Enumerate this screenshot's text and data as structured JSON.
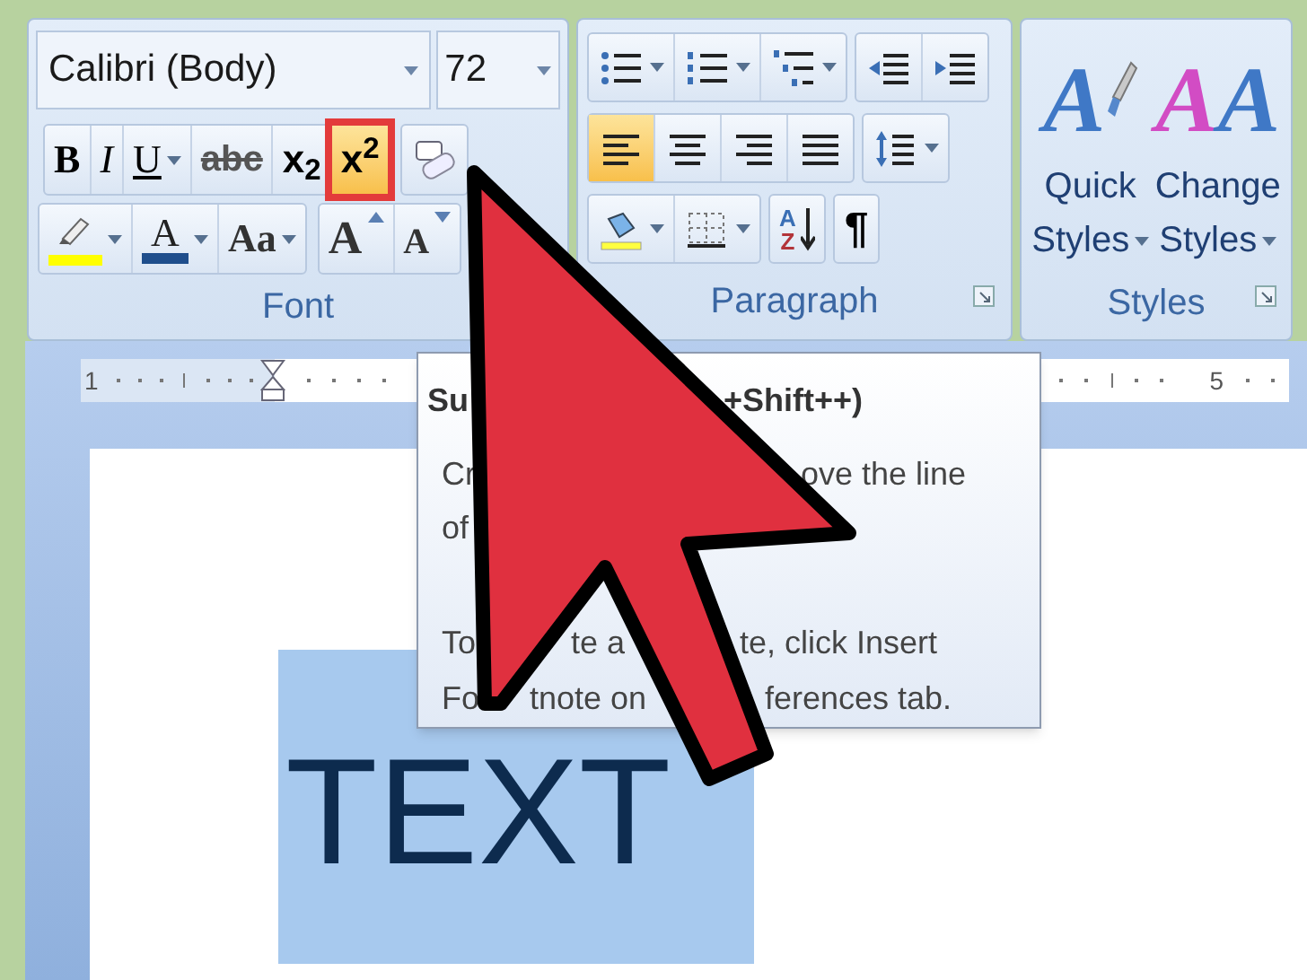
{
  "font": {
    "font_name": "Calibri (Body)",
    "font_size": "72",
    "rows": [
      [
        [
          {
            "kind": "bold",
            "label": "B",
            "dropdown": false,
            "selected": false
          },
          {
            "kind": "italic",
            "label": "I",
            "dropdown": false,
            "selected": false
          },
          {
            "kind": "underline",
            "label": "U",
            "dropdown": true,
            "selected": false
          },
          {
            "kind": "strikethrough",
            "label": "abc",
            "dropdown": false,
            "selected": false
          },
          {
            "kind": "subscript",
            "label": "x$_{2}$",
            "dropdown": false,
            "selected": false
          },
          {
            "kind": "superscript",
            "label": "x$^{2}$",
            "dropdown": false,
            "selected": true
          }
        ],
        [
          {
            "kind": "clear_formatting",
            "dropdown": false,
            "selected": false
          }
        ]
      ],
      [
        [
          {
            "kind": "highlight",
            "color": "#ffff00",
            "dropdown": true,
            "selected": false
          },
          {
            "kind": "font_color",
            "label": "A",
            "color": "#1f4e8c",
            "dropdown": true,
            "selected": false
          },
          {
            "kind": "change_case",
            "label": "Aa",
            "dropdown": true,
            "selected": false
          }
        ],
        [
          {
            "kind": "grow_font",
            "label": "A",
            "dropdown": false,
            "selected": false
          },
          {
            "kind": "shrink_font",
            "label": "A",
            "dropdown": false,
            "selected": false
          }
        ]
      ]
    ],
    "label": "Font"
  },
  "paragraph": {
    "rows": [
      [
        [
          {
            "kind": "bullets",
            "dropdown": true,
            "selected": false
          },
          {
            "kind": "numbering",
            "dropdown": true,
            "selected": false
          },
          {
            "kind": "multilevel",
            "dropdown": true,
            "selected": false
          }
        ],
        [
          {
            "kind": "decrease_indent",
            "dropdown": false,
            "selected": false
          },
          {
            "kind": "increase_indent",
            "dropdown": false,
            "selected": false
          }
        ]
      ],
      [
        [
          {
            "kind": "align_left",
            "dropdown": false,
            "selected": true
          },
          {
            "kind": "align_center",
            "dropdown": false,
            "selected": false
          },
          {
            "kind": "align_right",
            "dropdown": false,
            "selected": false
          },
          {
            "kind": "justify",
            "dropdown": false,
            "selected": false
          }
        ],
        [
          {
            "kind": "line_spacing",
            "dropdown": true,
            "selected": false
          }
        ]
      ],
      [
        [
          {
            "kind": "shading",
            "dropdown": true,
            "selected": false
          },
          {
            "kind": "borders",
            "dropdown": true,
            "selected": false
          }
        ],
        [
          {
            "kind": "sort",
            "labels": [
              "A",
              "Z"
            ],
            "dropdown": false,
            "selected": false
          }
        ],
        [
          {
            "kind": "pilcrow",
            "label": "¶",
            "dropdown": false,
            "selected": false
          }
        ]
      ]
    ],
    "label": "Paragraph"
  },
  "styles": {
    "buttons": [
      {
        "kind": "quick_styles",
        "icon_letters": [
          "A"
        ],
        "lines": [
          "Quick",
          "Styles"
        ],
        "dropdown": true
      },
      {
        "kind": "change_styles",
        "icon_letters": [
          "A",
          "A"
        ],
        "lines": [
          "Change",
          "Styles"
        ],
        "dropdown": true
      }
    ],
    "label": "Styles"
  },
  "ruler": {
    "numbers": [
      "1",
      "5"
    ]
  },
  "tooltip": {
    "title_parts": [
      "Su",
      "+Shift++)"
    ],
    "lines": [
      [
        "Cr",
        "ove the line"
      ],
      [
        "of"
      ],
      [
        "To",
        "te a",
        "te, click Insert"
      ],
      [
        "Fo",
        "tnote on",
        "ferences tab."
      ]
    ]
  },
  "document": {
    "text": "TEXT",
    "selected": true
  }
}
